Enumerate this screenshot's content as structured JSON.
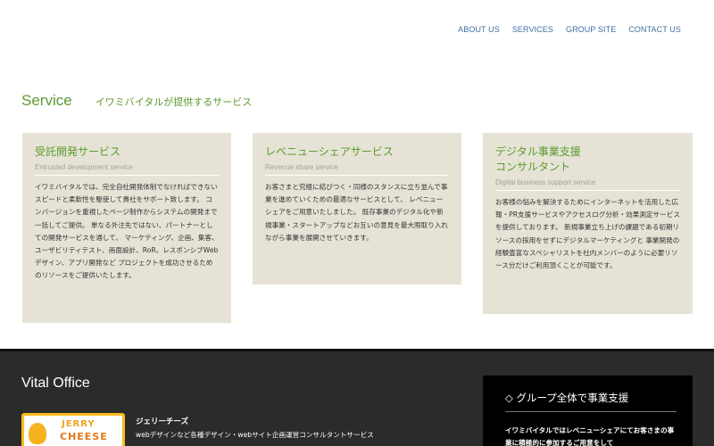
{
  "nav": {
    "items": [
      "ABOUT US",
      "SERVICES",
      "GROUP SITE",
      "CONTACT US"
    ]
  },
  "service": {
    "title": "Service",
    "subtitle": "イワミバイタルが提供するサービス"
  },
  "cards": [
    {
      "title": "受託開発サービス",
      "en": "Entrusted development service",
      "body": "イワミバイタルでは、完全自社開発体制でなければできないスピードと柔軟性を駆使して貴社をサポート致します。 コンバージョンを重視したページ制作からシステムの開発まで一括してご提供。 単なる外注先ではない、パートナーとしての開発サービスを通して、 マーケティング、企画、集客、ユーザビリティテスト、画面設計、RoR、レスポンシブWebデザイン、アプリ開発など プロジェクトを成功させるためのリソースをご提供いたします。"
    },
    {
      "title": "レベニューシェアサービス",
      "en": "Revenue share service",
      "body": "お客さまと究極に結びつく・同様のスタンスに立ち並んで事業を進めていくための最適なサービスとして、 レベニューシェアをご用意いたしました。 既存事業のデジタル化や新規事業・スタートアップなどお互いの意見を最大限取り入れながら事業を展開させていきます。"
    },
    {
      "title": "デジタル事業支援\nコンサルタント",
      "en": "Digital business support service",
      "body": "お客様の悩みを解決するためにインターネットを活用した広報・PR支援サービスやアクセスログ分析・効果測定サービスを提供しております。 新規事業立ち上げの課題である初期リソースの採用をせずにデジタルマーケティングと 事業開発の経験豊富なスペシャリストを社内メンバーのように必要リソース分だけご利用頂くことが可能です。"
    }
  ],
  "footer": {
    "title": "Vital Office",
    "logo_text_1": "JERRY",
    "logo_text_2": "CHEESE",
    "company_name": "ジェリーチーズ",
    "company_desc": "webデザインなど各種デザイン・webサイト企画運営コンサルタントサービス",
    "group_heading": "◇ グループ全体で事業支援",
    "group_text": "イワミバイタルではレベニューシェアにてお客さまの事業に積極的に参加するご用意をして"
  }
}
